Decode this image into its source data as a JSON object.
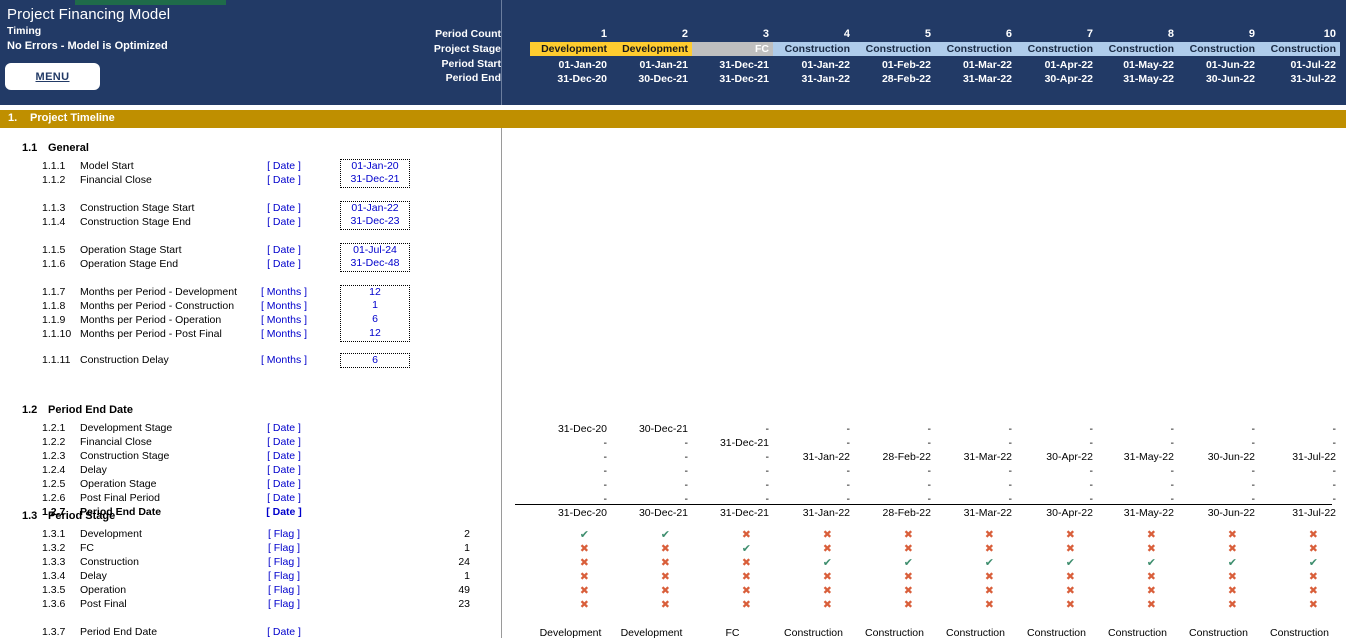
{
  "banner": {
    "title": "Project Financing Model",
    "subtitle": "Timing",
    "status": "No Errors - Model is Optimized",
    "menu_label": "MENU",
    "row_labels": [
      "Period Count",
      "Project Stage",
      "Period Start",
      "Period End"
    ],
    "bg_color": "#223A66",
    "accent_green": "#1F6B4A"
  },
  "periods": {
    "numbers": [
      "1",
      "2",
      "3",
      "4",
      "5",
      "6",
      "7",
      "8",
      "9",
      "10"
    ],
    "stages": [
      "Development",
      "Development",
      "FC",
      "Construction",
      "Construction",
      "Construction",
      "Construction",
      "Construction",
      "Construction",
      "Construction"
    ],
    "stage_kinds": [
      "dev",
      "dev",
      "fc",
      "cons",
      "cons",
      "cons",
      "cons",
      "cons",
      "cons",
      "cons"
    ],
    "starts": [
      "01-Jan-20",
      "01-Jan-21",
      "31-Dec-21",
      "01-Jan-22",
      "01-Feb-22",
      "01-Mar-22",
      "01-Apr-22",
      "01-May-22",
      "01-Jun-22",
      "01-Jul-22"
    ],
    "ends": [
      "31-Dec-20",
      "30-Dec-21",
      "31-Dec-21",
      "31-Jan-22",
      "28-Feb-22",
      "31-Mar-22",
      "30-Apr-22",
      "31-May-22",
      "30-Jun-22",
      "31-Jul-22"
    ],
    "stage_colors": {
      "dev": "#FFCC2F",
      "fc": "#BFBFBF",
      "cons": "#AFCCEB"
    }
  },
  "section": {
    "number": "1.",
    "title": "Project Timeline",
    "color": "#BF8F00"
  },
  "general": {
    "group_number": "1.1",
    "group_label": "General",
    "items": [
      {
        "num": "1.1.1",
        "label": "Model Start",
        "unit": "[ Date ]",
        "value": "01-Jan-20"
      },
      {
        "num": "1.1.2",
        "label": "Financial Close",
        "unit": "[ Date ]",
        "value": "31-Dec-21"
      },
      {
        "num": "1.1.3",
        "label": "Construction Stage Start",
        "unit": "[ Date ]",
        "value": "01-Jan-22"
      },
      {
        "num": "1.1.4",
        "label": "Construction Stage End",
        "unit": "[ Date ]",
        "value": "31-Dec-23"
      },
      {
        "num": "1.1.5",
        "label": "Operation Stage Start",
        "unit": "[ Date ]",
        "value": "01-Jul-24"
      },
      {
        "num": "1.1.6",
        "label": "Operation Stage End",
        "unit": "[ Date ]",
        "value": "31-Dec-48"
      },
      {
        "num": "1.1.7",
        "label": "Months per Period - Development",
        "unit": "[ Months ]",
        "value": "12"
      },
      {
        "num": "1.1.8",
        "label": "Months per Period - Construction",
        "unit": "[ Months ]",
        "value": "1"
      },
      {
        "num": "1.1.9",
        "label": "Months per Period - Operation",
        "unit": "[ Months ]",
        "value": "6"
      },
      {
        "num": "1.1.10",
        "label": "Months per Period - Post Final",
        "unit": "[ Months ]",
        "value": "12"
      },
      {
        "num": "1.1.11",
        "label": "Construction Delay",
        "unit": "[ Months ]",
        "value": "6"
      }
    ]
  },
  "period_end_date": {
    "group_number": "1.2",
    "group_label": "Period End Date",
    "rows": [
      {
        "num": "1.2.1",
        "label": "Development Stage",
        "unit": "[ Date ]",
        "bold": false,
        "values": [
          "31-Dec-20",
          "30-Dec-21",
          "-",
          "-",
          "-",
          "-",
          "-",
          "-",
          "-",
          "-"
        ]
      },
      {
        "num": "1.2.2",
        "label": "Financial Close",
        "unit": "[ Date ]",
        "bold": false,
        "values": [
          "-",
          "-",
          "31-Dec-21",
          "-",
          "-",
          "-",
          "-",
          "-",
          "-",
          "-"
        ]
      },
      {
        "num": "1.2.3",
        "label": "Construction Stage",
        "unit": "[ Date ]",
        "bold": false,
        "values": [
          "-",
          "-",
          "-",
          "31-Jan-22",
          "28-Feb-22",
          "31-Mar-22",
          "30-Apr-22",
          "31-May-22",
          "30-Jun-22",
          "31-Jul-22"
        ]
      },
      {
        "num": "1.2.4",
        "label": "Delay",
        "unit": "[ Date ]",
        "bold": false,
        "values": [
          "-",
          "-",
          "-",
          "-",
          "-",
          "-",
          "-",
          "-",
          "-",
          "-"
        ]
      },
      {
        "num": "1.2.5",
        "label": "Operation Stage",
        "unit": "[ Date ]",
        "bold": false,
        "values": [
          "-",
          "-",
          "-",
          "-",
          "-",
          "-",
          "-",
          "-",
          "-",
          "-"
        ]
      },
      {
        "num": "1.2.6",
        "label": "Post Final Period",
        "unit": "[ Date ]",
        "bold": false,
        "values": [
          "-",
          "-",
          "-",
          "-",
          "-",
          "-",
          "-",
          "-",
          "-",
          "-"
        ]
      },
      {
        "num": "1.2.7",
        "label": "Period End Date",
        "unit": "[ Date ]",
        "bold": true,
        "values": [
          "31-Dec-20",
          "30-Dec-21",
          "31-Dec-21",
          "31-Jan-22",
          "28-Feb-22",
          "31-Mar-22",
          "30-Apr-22",
          "31-May-22",
          "30-Jun-22",
          "31-Jul-22"
        ]
      }
    ]
  },
  "period_stage": {
    "group_number": "1.3",
    "group_label": "Period Stage",
    "rows": [
      {
        "num": "1.3.1",
        "label": "Development",
        "unit": "[ Flag ]",
        "count": "2",
        "flags": [
          1,
          1,
          0,
          0,
          0,
          0,
          0,
          0,
          0,
          0
        ]
      },
      {
        "num": "1.3.2",
        "label": "FC",
        "unit": "[ Flag ]",
        "count": "1",
        "flags": [
          0,
          0,
          1,
          0,
          0,
          0,
          0,
          0,
          0,
          0
        ]
      },
      {
        "num": "1.3.3",
        "label": "Construction",
        "unit": "[ Flag ]",
        "count": "24",
        "flags": [
          0,
          0,
          0,
          1,
          1,
          1,
          1,
          1,
          1,
          1
        ]
      },
      {
        "num": "1.3.4",
        "label": "Delay",
        "unit": "[ Flag ]",
        "count": "1",
        "flags": [
          0,
          0,
          0,
          0,
          0,
          0,
          0,
          0,
          0,
          0
        ]
      },
      {
        "num": "1.3.5",
        "label": "Operation",
        "unit": "[ Flag ]",
        "count": "49",
        "flags": [
          0,
          0,
          0,
          0,
          0,
          0,
          0,
          0,
          0,
          0
        ]
      },
      {
        "num": "1.3.6",
        "label": "Post Final",
        "unit": "[ Flag ]",
        "count": "23",
        "flags": [
          0,
          0,
          0,
          0,
          0,
          0,
          0,
          0,
          0,
          0
        ]
      }
    ],
    "end_row": {
      "num": "1.3.7",
      "label": "Period End Date",
      "unit": "[ Date ]",
      "values": [
        "Development",
        "Development",
        "FC",
        "Construction",
        "Construction",
        "Construction",
        "Construction",
        "Construction",
        "Construction",
        "Construction"
      ]
    },
    "flag_true_glyph": "✔",
    "flag_false_glyph": "✖",
    "flag_true_color": "#3E8E6E",
    "flag_false_color": "#D95F3B"
  }
}
